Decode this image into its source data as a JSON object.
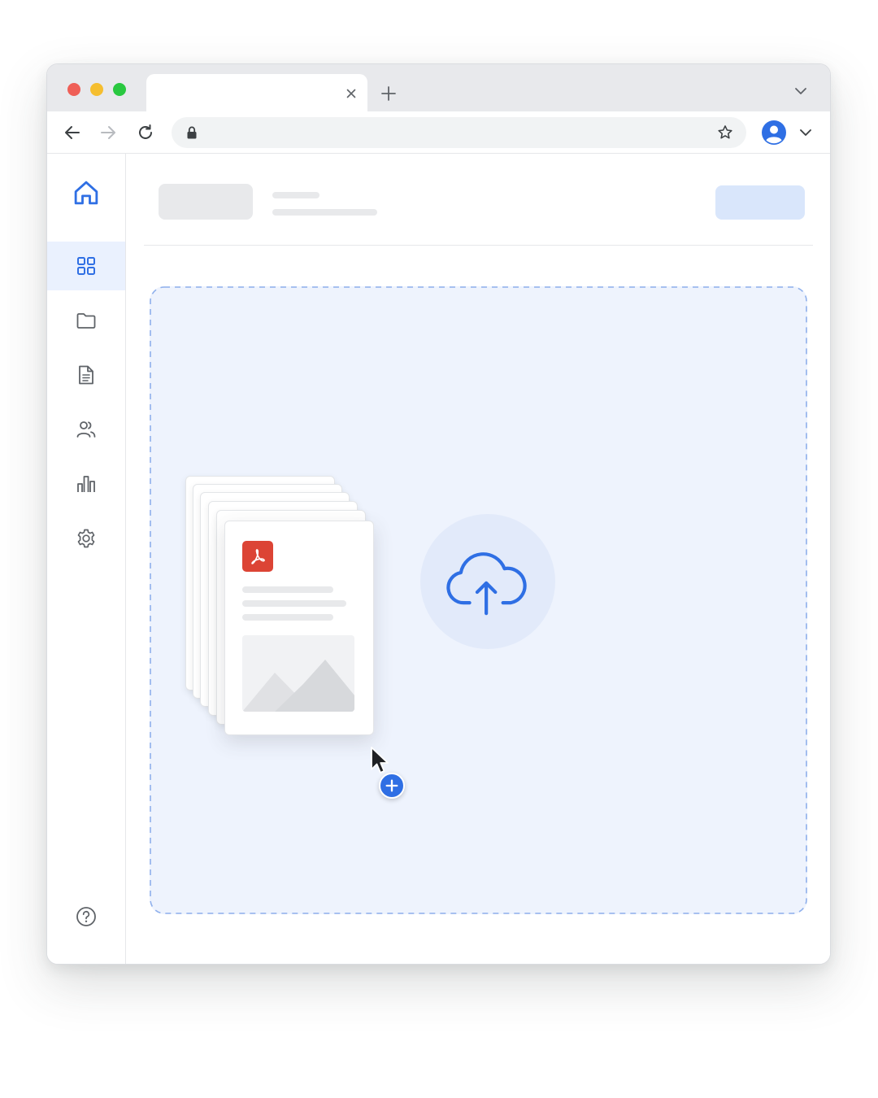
{
  "browser": {
    "tab": {
      "title": ""
    },
    "address_bar": {
      "url": ""
    },
    "traffic_lights": {
      "close": "#ef5f57",
      "minimize": "#f5be2f",
      "maximize": "#29c840"
    }
  },
  "sidebar": {
    "items": [
      {
        "name": "home",
        "icon": "home-icon",
        "active": false
      },
      {
        "name": "dashboard",
        "icon": "grid-icon",
        "active": true
      },
      {
        "name": "folders",
        "icon": "folder-icon",
        "active": false
      },
      {
        "name": "documents",
        "icon": "document-icon",
        "active": false
      },
      {
        "name": "users",
        "icon": "users-icon",
        "active": false
      },
      {
        "name": "analytics",
        "icon": "bar-chart-icon",
        "active": false
      },
      {
        "name": "settings",
        "icon": "gear-icon",
        "active": false
      },
      {
        "name": "help",
        "icon": "help-icon",
        "active": false
      }
    ]
  },
  "dropzone": {
    "file_type_icon": "pdf-icon",
    "upload_icon": "cloud-upload-icon",
    "drag_badge_icon": "plus-icon"
  },
  "colors": {
    "accent": "#2f6fe4",
    "accent_light": "#d9e6fb",
    "dropzone_bg": "#eef3fd",
    "dropzone_border": "#8fb0ec",
    "pdf_red": "#dc4435",
    "placeholder": "#e8e9eb"
  }
}
